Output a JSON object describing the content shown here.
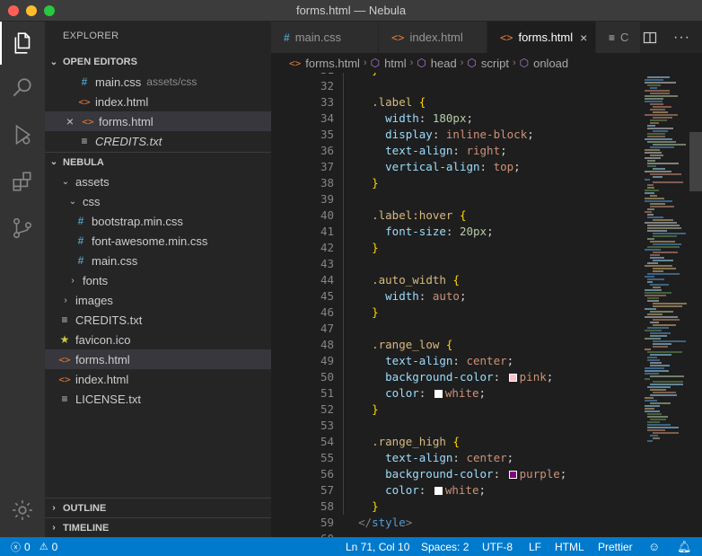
{
  "window": {
    "title": "forms.html — Nebula"
  },
  "activity_bar": {
    "items": [
      "explorer-icon",
      "search-icon",
      "debug-icon",
      "extensions-icon",
      "source-control-icon"
    ],
    "bottom": "settings-gear-icon"
  },
  "sidebar": {
    "header": "EXPLORER",
    "open_editors": {
      "title": "OPEN EDITORS",
      "items": [
        {
          "name": "main.css",
          "desc": "assets/css",
          "icon": "#"
        },
        {
          "name": "index.html",
          "desc": "",
          "icon": "<>"
        },
        {
          "name": "forms.html",
          "desc": "",
          "icon": "<>",
          "close": "×"
        },
        {
          "name": "CREDITS.txt",
          "desc": "",
          "icon": "≡"
        }
      ]
    },
    "project": {
      "title": "NEBULA",
      "items": [
        {
          "name": "assets",
          "twisty": "⌄"
        },
        {
          "name": "css",
          "twisty": "⌄"
        },
        {
          "name": "bootstrap.min.css",
          "icon": "#"
        },
        {
          "name": "font-awesome.min.css",
          "icon": "#"
        },
        {
          "name": "main.css",
          "icon": "#"
        },
        {
          "name": "fonts",
          "twisty": "›"
        },
        {
          "name": "images",
          "twisty": "›"
        },
        {
          "name": "CREDITS.txt",
          "icon": "≡"
        },
        {
          "name": "favicon.ico",
          "icon": "★"
        },
        {
          "name": "forms.html",
          "icon": "<>"
        },
        {
          "name": "index.html",
          "icon": "<>"
        },
        {
          "name": "LICENSE.txt",
          "icon": "≡"
        }
      ]
    },
    "outline": "OUTLINE",
    "timeline": "TIMELINE"
  },
  "tabs": [
    {
      "label": "main.css",
      "icon": "#"
    },
    {
      "label": "index.html",
      "icon": "<>"
    },
    {
      "label": "forms.html",
      "icon": "<>",
      "close": "×"
    },
    {
      "label": "C",
      "icon": "≡"
    }
  ],
  "breadcrumbs": [
    "forms.html",
    "html",
    "head",
    "script",
    "onload"
  ],
  "editor": {
    "first_line": 32,
    "lines": [
      "",
      "    .label {",
      "      width: 180px;",
      "      display: inline-block;",
      "      text-align: right;",
      "      vertical-align: top;",
      "    }",
      "",
      "    .label:hover {",
      "      font-size: 20px;",
      "    }",
      "",
      "    .auto_width {",
      "      width: auto;",
      "    }",
      "",
      "    .range_low {",
      "      text-align: center;",
      "      background-color: pink;",
      "      color: white;",
      "    }",
      "",
      "    .range_high {",
      "      text-align: center;",
      "      background-color: purple;",
      "      color: white;",
      "    }",
      "  </style>"
    ],
    "swatches": {
      "pink": "#ffc0cb",
      "purple": "#800080",
      "white": "#ffffff"
    }
  },
  "status_bar": {
    "errors": "0",
    "warnings": "0",
    "position": "Ln 71, Col 10",
    "spaces": "Spaces: 2",
    "encoding": "UTF-8",
    "eol": "LF",
    "language": "HTML",
    "formatter": "Prettier"
  },
  "colors": {
    "accent": "#007acc",
    "css_icon": "#519aba",
    "html_icon": "#e37933"
  }
}
